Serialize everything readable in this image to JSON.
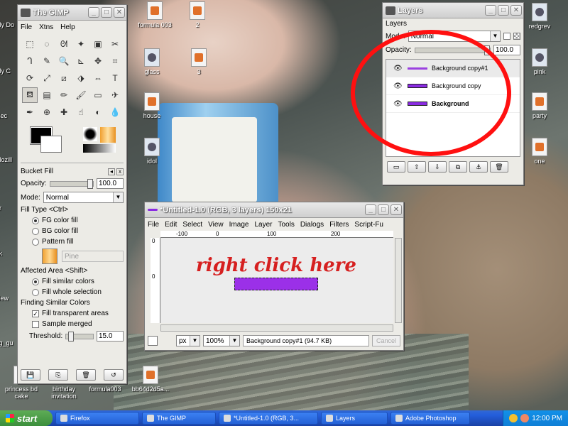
{
  "desktop": {
    "icons": [
      {
        "id": "formula003",
        "label": "formula 003",
        "kind": "file"
      },
      {
        "id": "two",
        "label": "2",
        "kind": "file"
      },
      {
        "id": "glass",
        "label": "glass",
        "kind": "cam"
      },
      {
        "id": "three",
        "label": "3",
        "kind": "file"
      },
      {
        "id": "house",
        "label": "house",
        "kind": "file"
      },
      {
        "id": "idol",
        "label": "idol",
        "kind": "cam"
      },
      {
        "id": "redgrev",
        "label": "redgrev",
        "kind": "cam"
      },
      {
        "id": "pink",
        "label": "pink",
        "kind": "cam"
      },
      {
        "id": "party",
        "label": "party",
        "kind": "file"
      },
      {
        "id": "one",
        "label": "one",
        "kind": "file"
      },
      {
        "id": "princessbdcake",
        "label": "princess bd cake",
        "kind": "file"
      },
      {
        "id": "birthdayinvitation",
        "label": "birthday invitation",
        "kind": "file"
      },
      {
        "id": "formula003b",
        "label": "formula003",
        "kind": "file"
      },
      {
        "id": "bb64d2d5a",
        "label": "bb64d2d5a...",
        "kind": "file"
      }
    ],
    "left_edge_labels": [
      "My Do",
      "My C",
      "Rec",
      "Mozill",
      "gr",
      "kk",
      "New",
      "sg_gu"
    ]
  },
  "gimp": {
    "title": "The GIMP",
    "menu": [
      "File",
      "Xtns",
      "Help"
    ],
    "tool_icons": [
      "rect-select-icon",
      "ellipse-select-icon",
      "free-select-icon",
      "fuzzy-select-icon",
      "color-select-icon",
      "scissors-icon",
      "paths-icon",
      "color-picker-icon",
      "zoom-icon",
      "measure-icon",
      "move-icon",
      "crop-icon",
      "rotate-icon",
      "scale-icon",
      "shear-icon",
      "perspective-icon",
      "flip-icon",
      "text-icon",
      "bucket-fill-icon",
      "blend-icon",
      "pencil-icon",
      "paintbrush-icon",
      "eraser-icon",
      "airbrush-icon",
      "ink-icon",
      "clone-icon",
      "heal-icon",
      "smudge-icon",
      "dodge-icon",
      "convolve-icon"
    ],
    "tool_glyphs": [
      "⬚",
      "◌",
      "ᘛ",
      "✦",
      "▣",
      "✂",
      "ᒉ",
      "✎",
      "🔍",
      "⊾",
      "✥",
      "⌗",
      "⟳",
      "⤢",
      "⧄",
      "⬗",
      "⇔",
      "T",
      "⛾",
      "▤",
      "✏",
      "🖌",
      "▭",
      "✈",
      "✒",
      "⊕",
      "✚",
      "☝",
      "◐",
      "💧"
    ],
    "active_tool_index": 18,
    "bucket_fill": {
      "header": "Bucket Fill",
      "opacity_label": "Opacity:",
      "opacity_value": "100.0",
      "opacity_level": 1.0,
      "mode_label": "Mode:",
      "mode_value": "Normal",
      "fill_type_label": "Fill Type  <Ctrl>",
      "fill_types": [
        "FG color fill",
        "BG color fill",
        "Pattern fill"
      ],
      "fill_type_selected": 0,
      "pattern_name": "Pine",
      "affected_area_label": "Affected Area  <Shift>",
      "affected_areas": [
        "Fill similar colors",
        "Fill whole selection"
      ],
      "affected_selected": 0,
      "finding_label": "Finding Similar Colors",
      "fill_transparent": "Fill transparent areas",
      "fill_transparent_checked": true,
      "sample_merged": "Sample merged",
      "sample_merged_checked": false,
      "threshold_label": "Threshold:",
      "threshold_value": "15.0",
      "threshold_level": 0.06
    }
  },
  "layers": {
    "title": "Layers",
    "header": "Layers",
    "mode_label": "Mode:",
    "mode_value": "Normal",
    "opacity_label": "Opacity:",
    "opacity_value": "100.0",
    "items": [
      {
        "name": "Background copy#1",
        "bold": false
      },
      {
        "name": "Background copy",
        "bold": false
      },
      {
        "name": "Background",
        "bold": true
      }
    ]
  },
  "image_window": {
    "title": "*Untitled-1.0 (RGB, 3 layers) 150x21",
    "menu": [
      "File",
      "Edit",
      "Select",
      "View",
      "Image",
      "Layer",
      "Tools",
      "Dialogs",
      "Filters",
      "Script-Fu"
    ],
    "ruler_ticks": [
      "-100",
      "0",
      "100",
      "200"
    ],
    "vruler_ticks": [
      "0",
      "0"
    ],
    "annotation": "right click here",
    "unit": "px",
    "zoom": "100%",
    "status": "Background copy#1 (94.7 KB)",
    "cancel": "Cancel"
  },
  "taskbar": {
    "start": "start",
    "tasks": [
      "Firefox",
      "The GIMP",
      "*Untitled-1.0 (RGB, 3...",
      "Layers",
      "Adobe Photoshop"
    ],
    "clock": "12:00 PM"
  }
}
